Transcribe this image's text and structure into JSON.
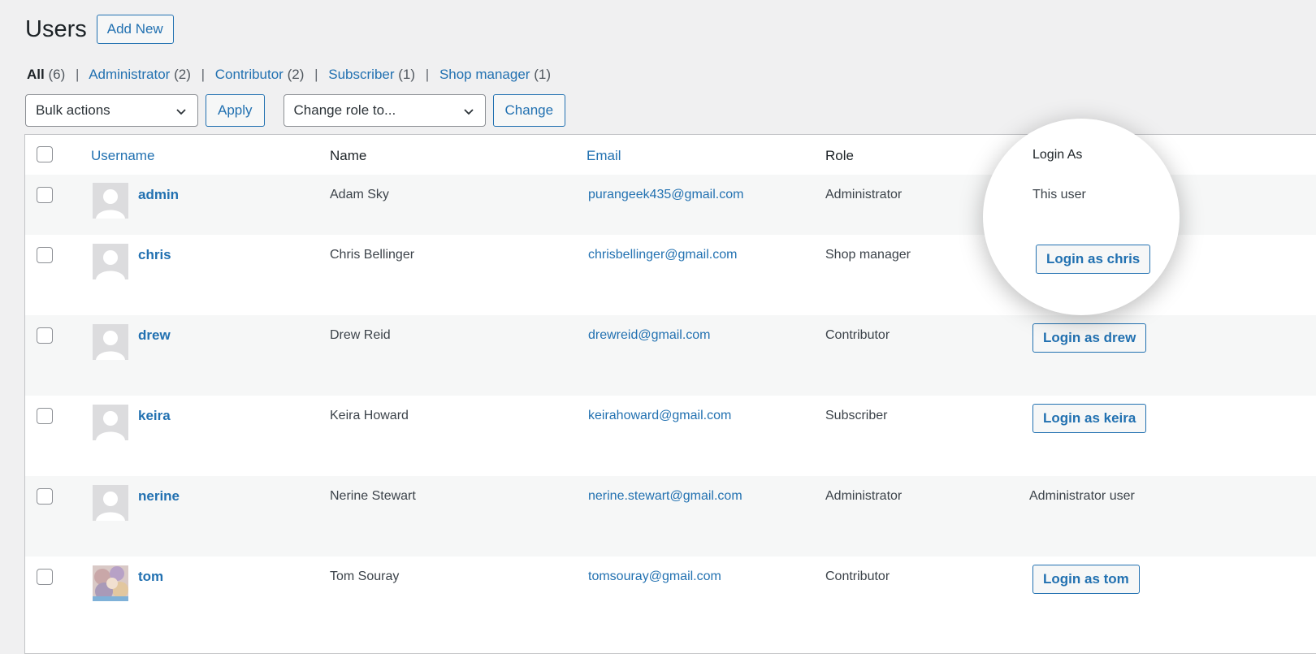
{
  "page": {
    "title": "Users",
    "add_new": "Add New"
  },
  "filters": {
    "all": {
      "label": "All",
      "count": "(6)"
    },
    "items": [
      {
        "label": "Administrator",
        "count": "(2)"
      },
      {
        "label": "Contributor",
        "count": "(2)"
      },
      {
        "label": "Subscriber",
        "count": "(1)"
      },
      {
        "label": "Shop manager",
        "count": "(1)"
      }
    ],
    "separator": "|"
  },
  "tablenav": {
    "bulk_actions": "Bulk actions",
    "apply": "Apply",
    "change_role": "Change role to...",
    "change": "Change"
  },
  "table": {
    "headers": {
      "username": "Username",
      "name": "Name",
      "email": "Email",
      "role": "Role",
      "login_as": "Login As"
    },
    "rows": [
      {
        "username": "admin",
        "name": "Adam Sky",
        "email": "purangeek435@gmail.com",
        "role": "Administrator",
        "login_as": "This user",
        "login_type": "text"
      },
      {
        "username": "chris",
        "name": "Chris Bellinger",
        "email": "chrisbellinger@gmail.com",
        "role": "Shop manager",
        "login_as": "Login as chris",
        "login_type": "button"
      },
      {
        "username": "drew",
        "name": "Drew Reid",
        "email": "drewreid@gmail.com",
        "role": "Contributor",
        "login_as": "Login as drew",
        "login_type": "button"
      },
      {
        "username": "keira",
        "name": "Keira Howard",
        "email": "keirahoward@gmail.com",
        "role": "Subscriber",
        "login_as": "Login as keira",
        "login_type": "button"
      },
      {
        "username": "nerine",
        "name": "Nerine Stewart",
        "email": "nerine.stewart@gmail.com",
        "role": "Administrator",
        "login_as": "Administrator user",
        "login_type": "text"
      },
      {
        "username": "tom",
        "name": "Tom Souray",
        "email": "tomsouray@gmail.com",
        "role": "Contributor",
        "login_as": "Login as tom",
        "login_type": "button"
      }
    ]
  },
  "colors": {
    "link": "#2271b1",
    "background": "#f0f0f1",
    "alt_row": "#f6f7f7"
  }
}
